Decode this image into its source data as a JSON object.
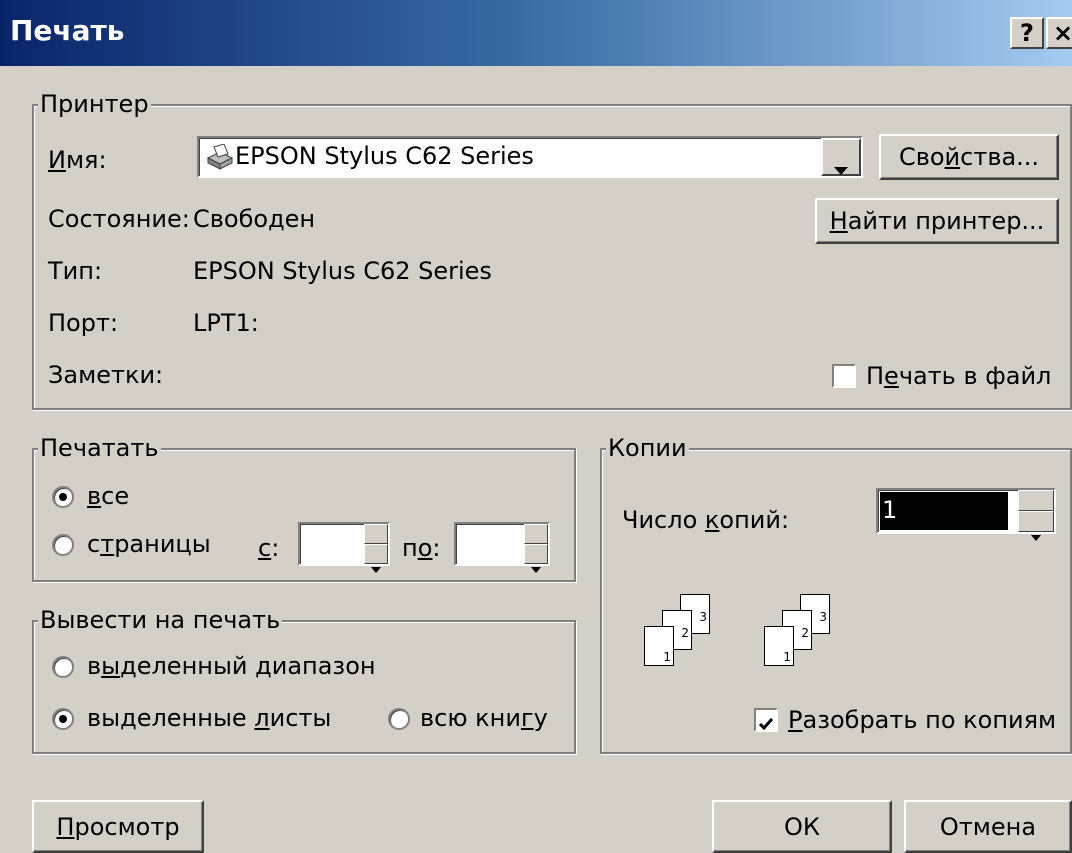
{
  "window": {
    "title": "Печать",
    "help_button": "?",
    "close_button": "×"
  },
  "printer": {
    "group_label": "Принтер",
    "name_label_u": "И",
    "name_label_rest": "мя:",
    "name_value": "EPSON Stylus C62 Series",
    "properties_button_pre": "Сво",
    "properties_button_u": "й",
    "properties_button_post": "ства...",
    "status_label": "Состояние:",
    "status_value": "Свободен",
    "find_printer_u": "Н",
    "find_printer_rest": "айти принтер...",
    "type_label": "Тип:",
    "type_value": "EPSON Stylus C62 Series",
    "port_label": "Порт:",
    "port_value": "LPT1:",
    "notes_label": "Заметки:",
    "print_to_file_pre": "П",
    "print_to_file_u": "е",
    "print_to_file_post": "чать в файл",
    "print_to_file_checked": false
  },
  "print_range": {
    "group_label": "Печатать",
    "all_u": "в",
    "all_rest": "се",
    "all_selected": true,
    "pages_pre": "с",
    "pages_u": "т",
    "pages_post": "раницы",
    "from_u": "с",
    "from_rest": ":",
    "from_value": "",
    "to_pre": "п",
    "to_u": "о",
    "to_post": ":",
    "to_value": ""
  },
  "print_what": {
    "group_label": "Вывести на печать",
    "selection_pre": "в",
    "selection_u": "ы",
    "selection_post": "деленный диапазон",
    "sheets_pre": "выделенные ",
    "sheets_u": "л",
    "sheets_post": "исты",
    "sheets_selected": true,
    "workbook_pre": "всю кни",
    "workbook_u": "г",
    "workbook_post": "у"
  },
  "copies": {
    "group_label": "Копии",
    "count_label_pre": "Число ",
    "count_label_u": "к",
    "count_label_post": "опий:",
    "count_value": "1",
    "collate_u": "Р",
    "collate_rest": "азобрать по копиям",
    "collate_checked": true,
    "page_labels": [
      "1",
      "2",
      "3"
    ]
  },
  "footer": {
    "preview_u": "П",
    "preview_rest": "росмотр",
    "ok": "ОК",
    "cancel": "Отмена"
  },
  "colors": {
    "face": "#d4d0c8",
    "title_start": "#0a246a",
    "title_end": "#a6caf0",
    "selection": "#000000"
  }
}
